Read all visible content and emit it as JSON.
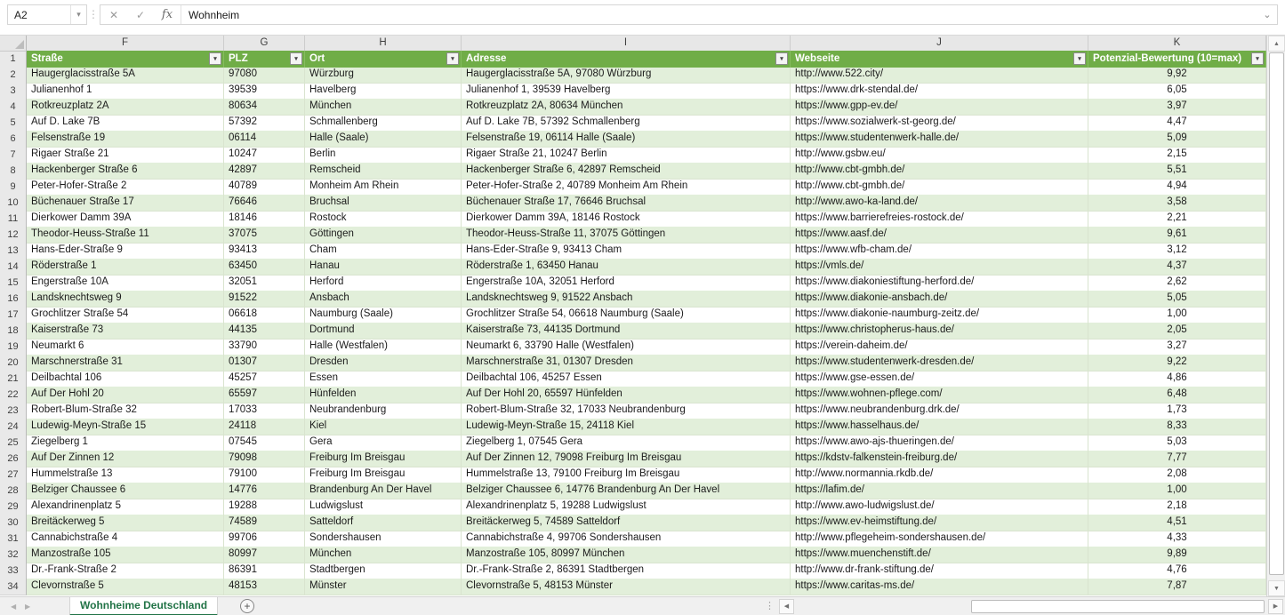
{
  "toolbar": {
    "name_box": "A2",
    "formula_value": "Wohnheim"
  },
  "icons": {
    "dropdown": "▾",
    "dots": "⋮",
    "cancel": "✕",
    "confirm": "✓",
    "fx": "fx",
    "chevron_down": "⌄",
    "filter_arrow": "▾",
    "nav_left": "◀",
    "nav_right": "▶",
    "scroll_up": "▲",
    "scroll_down": "▼",
    "scroll_left": "◀",
    "scroll_right": "▶",
    "add_sheet": "+"
  },
  "grid": {
    "column_letters": [
      "F",
      "G",
      "H",
      "I",
      "J",
      "K"
    ]
  },
  "table": {
    "header_row_number": "1",
    "headers": [
      "Straße",
      "PLZ",
      "Ort",
      "Adresse",
      "Webseite",
      "Potenzial-Bewertung (10=max)"
    ],
    "rows": [
      {
        "n": "2",
        "cells": [
          "Haugerglacisstraße 5A",
          "97080",
          "Würzburg",
          "Haugerglacisstraße 5A, 97080 Würzburg",
          "http://www.522.city/",
          "9,92"
        ]
      },
      {
        "n": "3",
        "cells": [
          "Julianenhof 1",
          "39539",
          "Havelberg",
          "Julianenhof 1, 39539 Havelberg",
          "https://www.drk-stendal.de/",
          "6,05"
        ]
      },
      {
        "n": "4",
        "cells": [
          "Rotkreuzplatz 2A",
          "80634",
          "München",
          "Rotkreuzplatz 2A, 80634 München",
          "https://www.gpp-ev.de/",
          "3,97"
        ]
      },
      {
        "n": "5",
        "cells": [
          "Auf D. Lake 7B",
          "57392",
          "Schmallenberg",
          "Auf D. Lake 7B, 57392 Schmallenberg",
          "https://www.sozialwerk-st-georg.de/",
          "4,47"
        ]
      },
      {
        "n": "6",
        "cells": [
          "Felsenstraße 19",
          "06114",
          "Halle (Saale)",
          "Felsenstraße 19, 06114 Halle (Saale)",
          "https://www.studentenwerk-halle.de/",
          "5,09"
        ]
      },
      {
        "n": "7",
        "cells": [
          "Rigaer Straße 21",
          "10247",
          "Berlin",
          "Rigaer Straße 21, 10247 Berlin",
          "http://www.gsbw.eu/",
          "2,15"
        ]
      },
      {
        "n": "8",
        "cells": [
          "Hackenberger Straße 6",
          "42897",
          "Remscheid",
          "Hackenberger Straße 6, 42897 Remscheid",
          "http://www.cbt-gmbh.de/",
          "5,51"
        ]
      },
      {
        "n": "9",
        "cells": [
          "Peter-Hofer-Straße 2",
          "40789",
          "Monheim Am Rhein",
          "Peter-Hofer-Straße 2, 40789 Monheim Am Rhein",
          "http://www.cbt-gmbh.de/",
          "4,94"
        ]
      },
      {
        "n": "10",
        "cells": [
          "Büchenauer Straße 17",
          "76646",
          "Bruchsal",
          "Büchenauer Straße 17, 76646 Bruchsal",
          "http://www.awo-ka-land.de/",
          "3,58"
        ]
      },
      {
        "n": "11",
        "cells": [
          "Dierkower Damm 39A",
          "18146",
          "Rostock",
          "Dierkower Damm 39A, 18146 Rostock",
          "https://www.barrierefreies-rostock.de/",
          "2,21"
        ]
      },
      {
        "n": "12",
        "cells": [
          "Theodor-Heuss-Straße 11",
          "37075",
          "Göttingen",
          "Theodor-Heuss-Straße 11, 37075 Göttingen",
          "https://www.aasf.de/",
          "9,61"
        ]
      },
      {
        "n": "13",
        "cells": [
          "Hans-Eder-Straße 9",
          "93413",
          "Cham",
          "Hans-Eder-Straße 9, 93413 Cham",
          "https://www.wfb-cham.de/",
          "3,12"
        ]
      },
      {
        "n": "14",
        "cells": [
          "Röderstraße 1",
          "63450",
          "Hanau",
          "Röderstraße 1, 63450 Hanau",
          "https://vmls.de/",
          "4,37"
        ]
      },
      {
        "n": "15",
        "cells": [
          "Engerstraße 10A",
          "32051",
          "Herford",
          "Engerstraße 10A, 32051 Herford",
          "https://www.diakoniestiftung-herford.de/",
          "2,62"
        ]
      },
      {
        "n": "16",
        "cells": [
          "Landsknechtsweg 9",
          "91522",
          "Ansbach",
          "Landsknechtsweg 9, 91522 Ansbach",
          "https://www.diakonie-ansbach.de/",
          "5,05"
        ]
      },
      {
        "n": "17",
        "cells": [
          "Grochlitzer Straße 54",
          "06618",
          "Naumburg (Saale)",
          "Grochlitzer Straße 54, 06618 Naumburg (Saale)",
          "https://www.diakonie-naumburg-zeitz.de/",
          "1,00"
        ]
      },
      {
        "n": "18",
        "cells": [
          "Kaiserstraße 73",
          "44135",
          "Dortmund",
          "Kaiserstraße 73, 44135 Dortmund",
          "https://www.christopherus-haus.de/",
          "2,05"
        ]
      },
      {
        "n": "19",
        "cells": [
          "Neumarkt 6",
          "33790",
          "Halle (Westfalen)",
          "Neumarkt 6, 33790 Halle (Westfalen)",
          "https://verein-daheim.de/",
          "3,27"
        ]
      },
      {
        "n": "20",
        "cells": [
          "Marschnerstraße 31",
          "01307",
          "Dresden",
          "Marschnerstraße 31, 01307 Dresden",
          "https://www.studentenwerk-dresden.de/",
          "9,22"
        ]
      },
      {
        "n": "21",
        "cells": [
          "Deilbachtal 106",
          "45257",
          "Essen",
          "Deilbachtal 106, 45257 Essen",
          "https://www.gse-essen.de/",
          "4,86"
        ]
      },
      {
        "n": "22",
        "cells": [
          "Auf Der Hohl 20",
          "65597",
          "Hünfelden",
          "Auf Der Hohl 20, 65597 Hünfelden",
          "https://www.wohnen-pflege.com/",
          "6,48"
        ]
      },
      {
        "n": "23",
        "cells": [
          "Robert-Blum-Straße 32",
          "17033",
          "Neubrandenburg",
          "Robert-Blum-Straße 32, 17033 Neubrandenburg",
          "https://www.neubrandenburg.drk.de/",
          "1,73"
        ]
      },
      {
        "n": "24",
        "cells": [
          "Ludewig-Meyn-Straße 15",
          "24118",
          "Kiel",
          "Ludewig-Meyn-Straße 15, 24118 Kiel",
          "https://www.hasselhaus.de/",
          "8,33"
        ]
      },
      {
        "n": "25",
        "cells": [
          "Ziegelberg 1",
          "07545",
          "Gera",
          "Ziegelberg 1, 07545 Gera",
          "https://www.awo-ajs-thueringen.de/",
          "5,03"
        ]
      },
      {
        "n": "26",
        "cells": [
          "Auf Der Zinnen 12",
          "79098",
          "Freiburg Im Breisgau",
          "Auf Der Zinnen 12, 79098 Freiburg Im Breisgau",
          "https://kdstv-falkenstein-freiburg.de/",
          "7,77"
        ]
      },
      {
        "n": "27",
        "cells": [
          "Hummelstraße 13",
          "79100",
          "Freiburg Im Breisgau",
          "Hummelstraße 13, 79100 Freiburg Im Breisgau",
          "http://www.normannia.rkdb.de/",
          "2,08"
        ]
      },
      {
        "n": "28",
        "cells": [
          "Belziger Chaussee 6",
          "14776",
          "Brandenburg An Der Havel",
          "Belziger Chaussee 6, 14776 Brandenburg An Der Havel",
          "https://lafim.de/",
          "1,00"
        ]
      },
      {
        "n": "29",
        "cells": [
          "Alexandrinenplatz 5",
          "19288",
          "Ludwigslust",
          "Alexandrinenplatz 5, 19288 Ludwigslust",
          "http://www.awo-ludwigslust.de/",
          "2,18"
        ]
      },
      {
        "n": "30",
        "cells": [
          "Breitäckerweg 5",
          "74589",
          "Satteldorf",
          "Breitäckerweg 5, 74589 Satteldorf",
          "https://www.ev-heimstiftung.de/",
          "4,51"
        ]
      },
      {
        "n": "31",
        "cells": [
          "Cannabichstraße 4",
          "99706",
          "Sondershausen",
          "Cannabichstraße 4, 99706 Sondershausen",
          "http://www.pflegeheim-sondershausen.de/",
          "4,33"
        ]
      },
      {
        "n": "32",
        "cells": [
          "Manzostraße 105",
          "80997",
          "München",
          "Manzostraße 105, 80997 München",
          "https://www.muenchenstift.de/",
          "9,89"
        ]
      },
      {
        "n": "33",
        "cells": [
          "Dr.-Frank-Straße 2",
          "86391",
          "Stadtbergen",
          "Dr.-Frank-Straße 2, 86391 Stadtbergen",
          "http://www.dr-frank-stiftung.de/",
          "4,76"
        ]
      },
      {
        "n": "34",
        "cells": [
          "Clevornstraße 5",
          "48153",
          "Münster",
          "Clevornstraße 5, 48153 Münster",
          "https://www.caritas-ms.de/",
          "7,87"
        ]
      }
    ]
  },
  "sheet_bar": {
    "tab_label": "Wohnheime Deutschland"
  },
  "colors": {
    "header_green": "#70AD47",
    "band_green": "#E2EFDA",
    "tab_green": "#217346"
  }
}
